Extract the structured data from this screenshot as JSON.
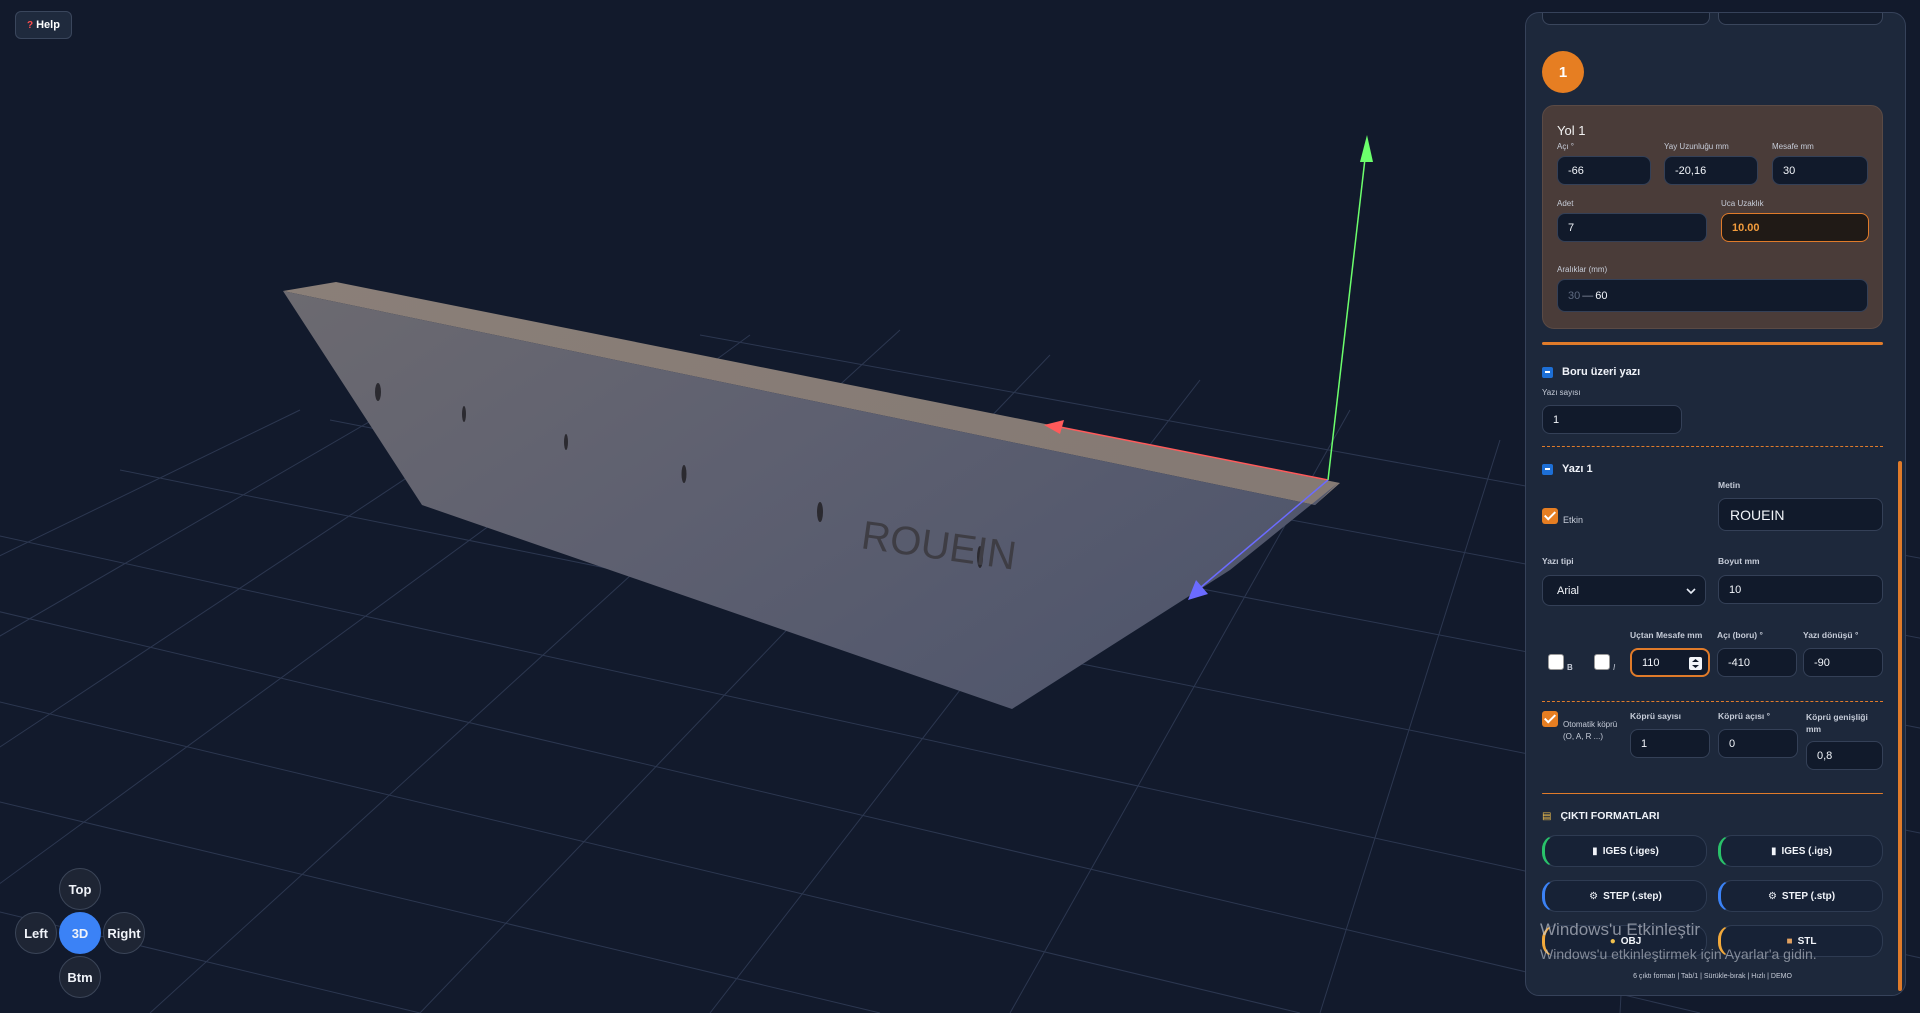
{
  "toolbar": {
    "help_label": "Help"
  },
  "view_cube": {
    "top": "Top",
    "left": "Left",
    "center": "3D",
    "right": "Right",
    "bottom": "Btm",
    "active": "3D"
  },
  "model": {
    "engraved_text": "ROUEIN"
  },
  "panel": {
    "path_badge": "1",
    "yol": {
      "title": "Yol 1",
      "aci_label": "Açı °",
      "aci_value": "-66",
      "yay_label": "Yay Uzunluğu mm",
      "yay_value": "-20,16",
      "mesafe_label": "Mesafe mm",
      "mesafe_value": "30",
      "adet_label": "Adet",
      "adet_value": "7",
      "uca_label": "Uca Uzaklık",
      "uca_value": "10.00",
      "araliklar_label": "Aralıklar (mm)",
      "araliklar_prefix": "30",
      "araliklar_value": "60"
    },
    "boru": {
      "title": "Boru üzeri yazı",
      "yazi_sayisi_label": "Yazı sayısı",
      "yazi_sayisi_value": "1"
    },
    "yazi1": {
      "title": "Yazı 1",
      "etkin_label": "Etkin",
      "metin_label": "Metin",
      "metin_value": "ROUEIN",
      "yazi_tipi_label": "Yazı tipi",
      "yazi_tipi_value": "Arial",
      "boyut_label": "Boyut mm",
      "boyut_value": "10",
      "bold_label": "B",
      "italic_label": "I",
      "uctan_label": "Uçtan Mesafe mm",
      "uctan_value": "110",
      "aci_boru_label": "Açı (boru) °",
      "aci_boru_value": "-410",
      "donusu_label": "Yazı dönüşü °",
      "donusu_value": "-90",
      "oto_kopru_label": "Otomatik köprü (O, A, R ...)",
      "kopru_sayisi_label": "Köprü sayısı",
      "kopru_sayisi_value": "1",
      "kopru_acisi_label": "Köprü açısı °",
      "kopru_acisi_value": "0",
      "kopru_genisligi_label": "Köprü genişliği mm",
      "kopru_genisligi_value": "0,8"
    },
    "cikti": {
      "title": "ÇIKTI FORMATLARI",
      "buttons": [
        "IGES (.iges)",
        "IGES (.igs)",
        "STEP (.step)",
        "STEP (.stp)",
        "OBJ",
        "STL"
      ]
    },
    "footer": "6 çıktı formatı | Tab/1 | Sürükle-bırak | Hızlı | DEMO"
  },
  "watermark": {
    "title": "Windows'u Etkinleştir",
    "subtitle": "Windows'u etkinleştirmek için Ayarlar'a gidin."
  },
  "colors": {
    "background": "#121a2c",
    "accent_orange": "#e67e22",
    "accent_blue": "#3b82f6",
    "axis_x": "#ff4d4d",
    "axis_y": "#66ff66",
    "axis_z": "#6666ff"
  }
}
